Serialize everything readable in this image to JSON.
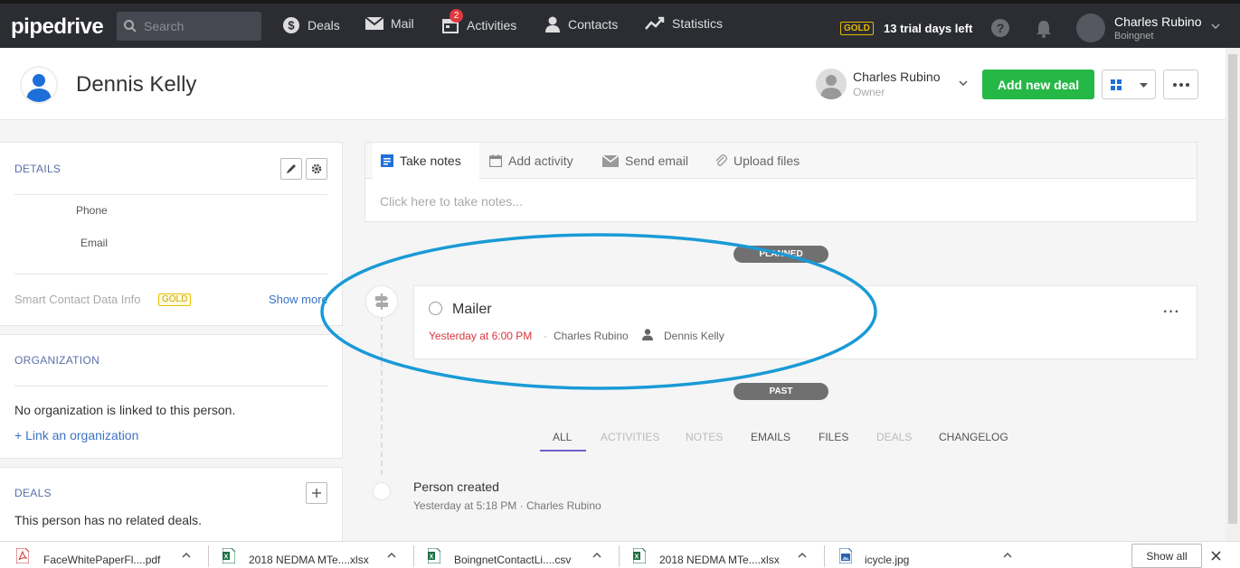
{
  "topbar": {
    "logo": "pipedrive",
    "search_placeholder": "Search",
    "nav": [
      {
        "label": "Deals",
        "icon": "dollar-icon"
      },
      {
        "label": "Mail",
        "icon": "mail-icon"
      },
      {
        "label": "Activities",
        "icon": "calendar-icon",
        "badge": "2"
      },
      {
        "label": "Contacts",
        "icon": "person-icon"
      },
      {
        "label": "Statistics",
        "icon": "trend-icon"
      }
    ],
    "plan_badge": "GOLD",
    "trial_text": "13 trial days left",
    "user_name": "Charles Rubino",
    "user_org": "Boingnet"
  },
  "header": {
    "person_name": "Dennis Kelly",
    "owner_name": "Charles Rubino",
    "owner_label": "Owner",
    "add_deal_label": "Add new deal"
  },
  "details": {
    "title": "DETAILS",
    "phone_label": "Phone",
    "email_label": "Email",
    "smart_label": "Smart Contact Data Info",
    "smart_badge": "GOLD",
    "show_more": "Show more"
  },
  "organization": {
    "title": "ORGANIZATION",
    "empty_text": "No organization is linked to this person.",
    "link_text": "+ Link an organization"
  },
  "deals": {
    "title": "DEALS",
    "empty_text": "This person has no related deals."
  },
  "composer": {
    "tabs": [
      "Take notes",
      "Add activity",
      "Send email",
      "Upload files"
    ],
    "placeholder": "Click here to take notes..."
  },
  "timeline": {
    "planned_label": "PLANNED",
    "past_label": "PAST",
    "activity": {
      "title": "Mailer",
      "time": "Yesterday at 6:00 PM",
      "separator": "·",
      "owner": "Charles Rubino",
      "person": "Dennis Kelly",
      "more": "···"
    },
    "filters": [
      "ALL",
      "ACTIVITIES",
      "NOTES",
      "EMAILS",
      "FILES",
      "DEALS",
      "CHANGELOG"
    ],
    "person_created": {
      "title": "Person created",
      "meta": "Yesterday at 5:18 PM  ·  Charles Rubino"
    }
  },
  "downloads": {
    "items": [
      {
        "name": "FaceWhitePaperFl....pdf",
        "icon": "pdf-icon"
      },
      {
        "name": "2018 NEDMA MTe....xlsx",
        "icon": "excel-icon"
      },
      {
        "name": "BoingnetContactLi....csv",
        "icon": "excel-icon"
      },
      {
        "name": "2018 NEDMA MTe....xlsx",
        "icon": "excel-icon"
      },
      {
        "name": "icycle.jpg",
        "icon": "image-icon"
      }
    ],
    "show_all": "Show all"
  },
  "colors": {
    "accent_green": "#25b847",
    "link_blue": "#3b73c4",
    "highlight": "#1a9ad6",
    "overdue_red": "#d9363e"
  }
}
